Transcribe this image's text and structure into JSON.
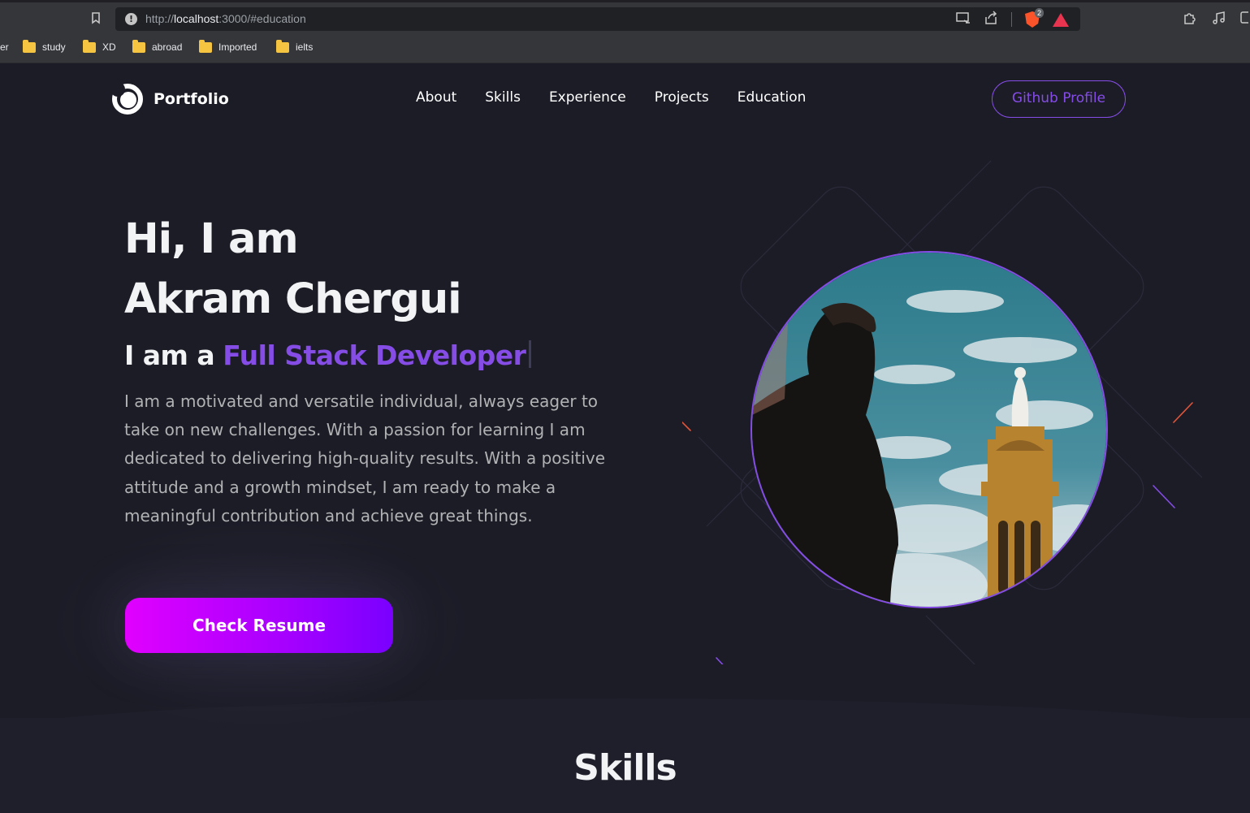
{
  "browser": {
    "url_prefix": "http://",
    "url_host": "localhost",
    "url_rest": ":3000/#education",
    "shield_count": "2",
    "bookmarks": [
      {
        "label": "er"
      },
      {
        "label": "study"
      },
      {
        "label": "XD"
      },
      {
        "label": "abroad"
      },
      {
        "label": "Imported"
      },
      {
        "label": "ielts"
      }
    ]
  },
  "nav": {
    "logo_text": "Portfolio",
    "items": [
      "About",
      "Skills",
      "Experience",
      "Projects",
      "Education"
    ],
    "github_label": "Github Profile"
  },
  "hero": {
    "title_line1": "Hi, I am",
    "title_line2": "Akram Chergui",
    "role_prefix": "I am a",
    "role": "Full Stack Developer",
    "description": "I am a motivated and versatile individual, always eager to take on new challenges. With a passion for learning I am dedicated to delivering high-quality results. With a positive attitude and a growth mindset, I am ready to make a meaningful contribution and achieve great things.",
    "resume_label": "Check Resume"
  },
  "skills": {
    "title": "Skills"
  },
  "colors": {
    "accent": "#854ce6",
    "background": "#1c1c27",
    "button_gradient_start": "#e100ff",
    "button_gradient_end": "#7a00ff"
  }
}
